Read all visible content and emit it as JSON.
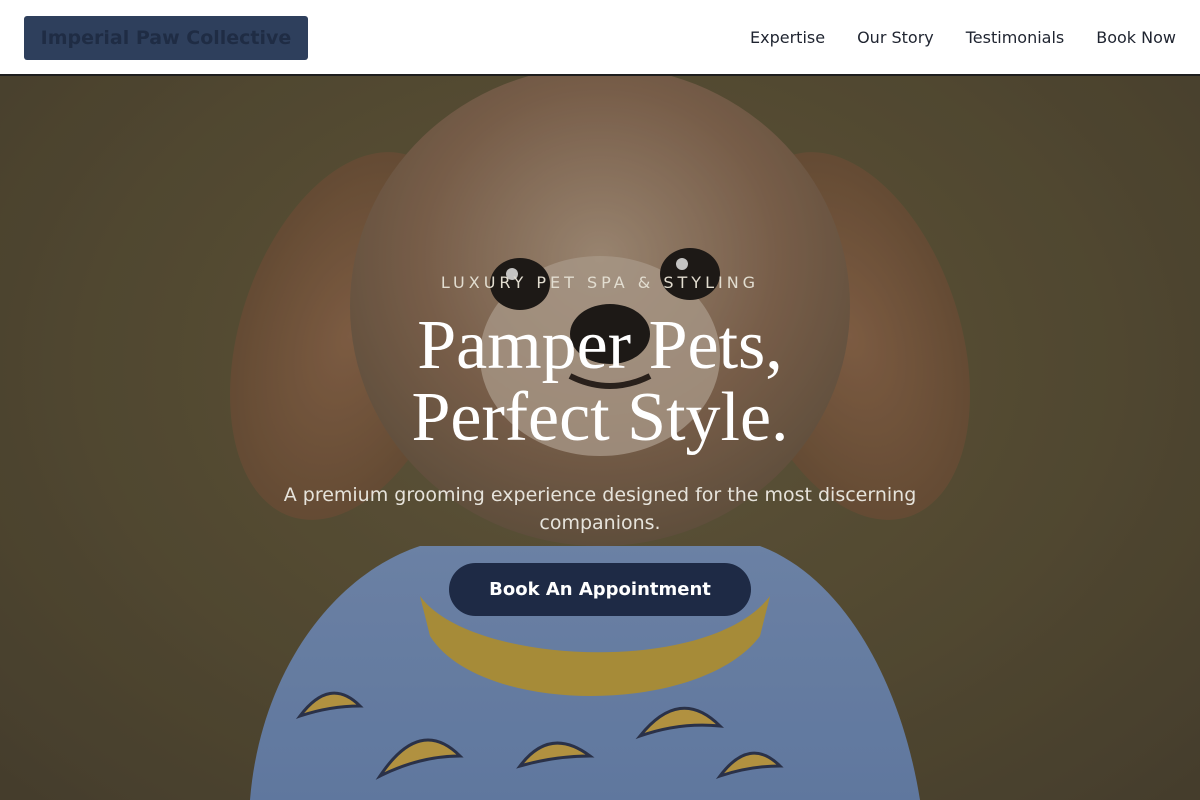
{
  "header": {
    "brand": "Imperial Paw Collective",
    "nav": [
      {
        "label": "Expertise"
      },
      {
        "label": "Our Story"
      },
      {
        "label": "Testimonials"
      },
      {
        "label": "Book Now"
      }
    ]
  },
  "hero": {
    "eyebrow": "LUXURY PET SPA & STYLING",
    "headline_line1": "Pamper Pets,",
    "headline_line2": "Perfect Style.",
    "subtitle": "A premium grooming experience designed for the most discerning companions.",
    "cta_label": "Book An Appointment",
    "image_alt": "small fluffy dog wearing a blue banana-print shirt"
  },
  "colors": {
    "header_bg": "#ffffff",
    "brand_bg": "#2e3f5c",
    "brand_text": "#1f2c44",
    "cta_bg": "#1e2a45",
    "hero_bg": "#5d5336",
    "shirt_blue": "#7f9fd0",
    "banana_yellow": "#d8b04a"
  }
}
